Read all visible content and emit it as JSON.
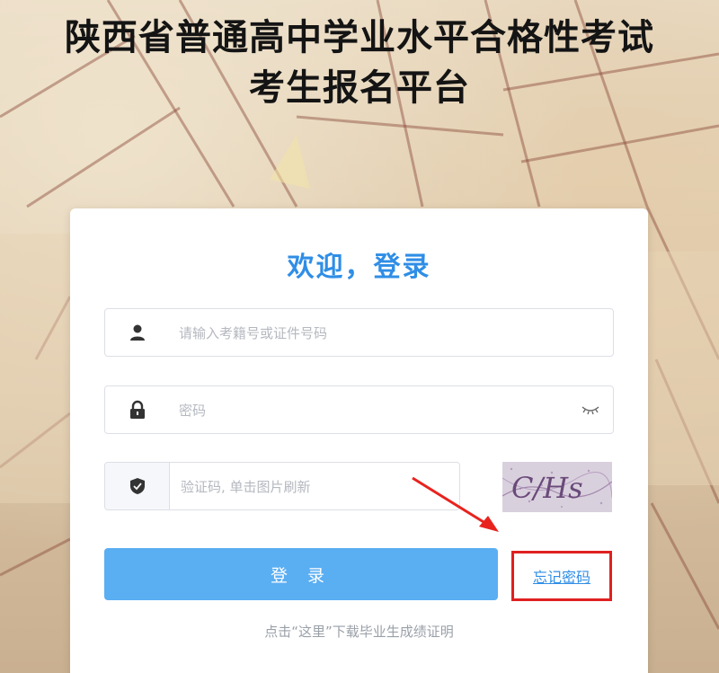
{
  "header": {
    "title_line1": "陕西省普通高中学业水平合格性考试",
    "title_line2": "考生报名平台"
  },
  "login": {
    "welcome": "欢迎，登录",
    "username_placeholder": "请输入考籍号或证件号码",
    "password_placeholder": "密码",
    "captcha_placeholder": "验证码, 单击图片刷新",
    "captcha_text": "C/Hs",
    "login_button": "登 录",
    "forgot_password": "忘记密码",
    "download_link": "点击“这里”下载毕业生成绩证明"
  },
  "colors": {
    "accent": "#2f8ee6",
    "button": "#5aaef2",
    "highlight": "#e02020"
  },
  "icons": {
    "username": "user-icon",
    "password": "lock-icon",
    "captcha": "shield-icon",
    "toggle_password": "eye-closed-icon"
  }
}
